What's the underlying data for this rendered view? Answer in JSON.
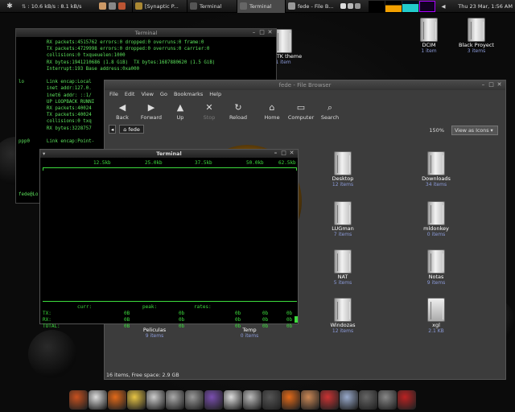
{
  "topbar": {
    "net_speed": ": 10.6 kB/s : 8.1 kB/s",
    "tasks": [
      {
        "label": "[Synaptic P...",
        "icon": "package-icon"
      },
      {
        "label": "Terminal",
        "icon": "terminal-icon"
      },
      {
        "label": "Terminal",
        "icon": "terminal-icon",
        "active": true
      },
      {
        "label": "fede - File B...",
        "icon": "folder-icon"
      }
    ],
    "clock": "Thu 23 Mar,  1:56 AM"
  },
  "desktop_icons": [
    {
      "label": "ed GTK theme",
      "sub": "1 item"
    },
    {
      "label": "DCIM",
      "sub": "1 item"
    },
    {
      "label": "Black Proyect",
      "sub": "3 items"
    }
  ],
  "term1": {
    "title": "Terminal",
    "lines": [
      "          RX packets:4515762 errors:0 dropped:0 overruns:0 frame:0",
      "          TX packets:4729998 errors:0 dropped:0 overruns:0 carrier:0",
      "          collisions:0 txqueuelen:1000",
      "          RX bytes:1941210686 (1.8 GiB)  TX bytes:1687880620 (1.5 GiB)",
      "          Interrupt:193 Base address:0xa000",
      "",
      "lo        Link encap:Local",
      "          inet addr:127.0.",
      "          inet6 addr: ::1/",
      "          UP LOOPBACK RUNNI",
      "          RX packets:40024",
      "          TX packets:40024",
      "          collisions:0 txq",
      "          RX bytes:3228757",
      "",
      "ppp0      Link encap:Point-",
      "",
      "",
      "",
      "",
      "",
      "",
      "",
      "fede@Lo"
    ]
  },
  "filebrowser": {
    "title": "fede - File Browser",
    "menu": [
      "File",
      "Edit",
      "View",
      "Go",
      "Bookmarks",
      "Help"
    ],
    "toolbar": [
      {
        "label": "Back",
        "icon": "back-arrow-icon",
        "disabled": false
      },
      {
        "label": "Forward",
        "icon": "forward-arrow-icon",
        "disabled": false
      },
      {
        "label": "Up",
        "icon": "up-arrow-icon",
        "disabled": false
      },
      {
        "label": "Stop",
        "icon": "stop-icon",
        "disabled": true
      },
      {
        "label": "Reload",
        "icon": "reload-icon",
        "disabled": false
      },
      {
        "label": "Home",
        "icon": "home-icon",
        "disabled": false
      },
      {
        "label": "Computer",
        "icon": "computer-icon",
        "disabled": false
      },
      {
        "label": "Search",
        "icon": "search-icon",
        "disabled": false
      }
    ],
    "location": "fede",
    "zoom": "150%",
    "view_mode": "View as Icons",
    "items": [
      {
        "label": "Desktop",
        "sub": "12 items"
      },
      {
        "label": "Downloads",
        "sub": "34 items"
      },
      {
        "label": "LUGman",
        "sub": "7 items"
      },
      {
        "label": "mldonkey",
        "sub": "0 items"
      },
      {
        "label": "NAT",
        "sub": "5 items"
      },
      {
        "label": "Notas",
        "sub": "9 items"
      },
      {
        "label": "Windozas",
        "sub": "12 items"
      },
      {
        "label": "xgl",
        "sub": "2.1 KB"
      },
      {
        "label": "Peliculas",
        "sub": "9 items"
      },
      {
        "label": "Temp",
        "sub": "0 items"
      }
    ],
    "status": "16 items, Free space: 2.9 GB"
  },
  "term2": {
    "title": "Terminal",
    "scale": [
      "12.5kb",
      "25.0kb",
      "37.5kb",
      "50.0kb",
      "62.5kb"
    ],
    "headers": {
      "curr": "curr:",
      "peak": "peak:",
      "rates": "rates:"
    },
    "rows": [
      {
        "label": "TX:",
        "curr": "0B",
        "peak": "0b",
        "r1": "0b",
        "r2": "0b",
        "r3": "0b"
      },
      {
        "label": "RX:",
        "curr": "0B",
        "peak": "0b",
        "r1": "0b",
        "r2": "0b",
        "r3": "0b"
      },
      {
        "label": "TOTAL:",
        "curr": "0B",
        "peak": "0b",
        "r1": "0b",
        "r2": "0b",
        "r3": "0b"
      }
    ]
  },
  "dock": [
    "ubuntu-icon",
    "disk-icon",
    "firefox-icon",
    "lamp-icon",
    "document-icon",
    "gimp-icon",
    "hand-icon",
    "nvu-icon",
    "music-icon",
    "disc-icon",
    "media-icon",
    "firefox-icon",
    "home-icon",
    "tools-icon",
    "windows-icon",
    "trash-icon",
    "power-icon",
    "media-player-icon"
  ]
}
